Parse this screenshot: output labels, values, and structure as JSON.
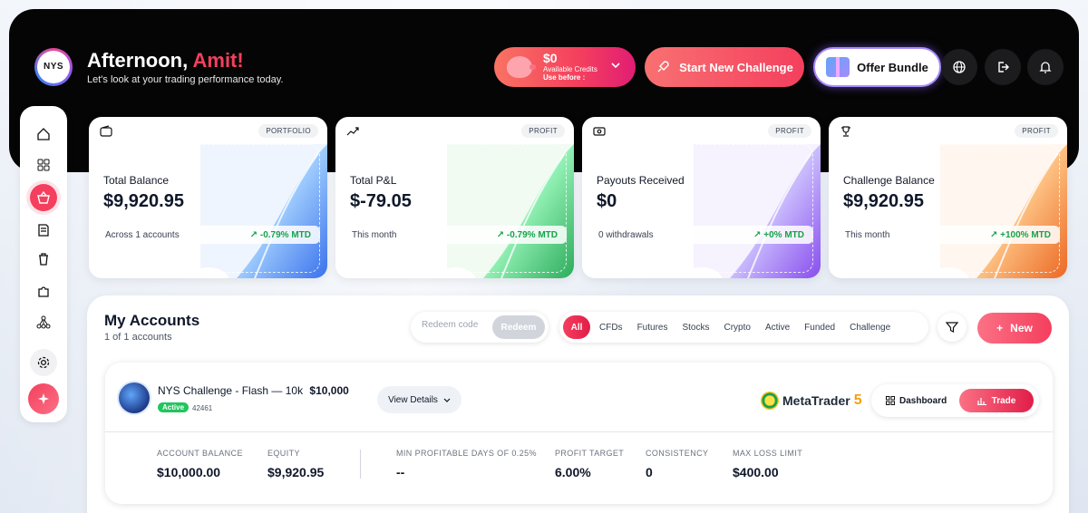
{
  "header": {
    "greeting_prefix": "Afternoon,",
    "greeting_name": "Amit!",
    "subtitle": "Let's look at your trading performance today.",
    "logo_text": "NYS",
    "credits": {
      "amount": "$0",
      "label": "Available Credits",
      "use_before": "Use before :"
    },
    "start_challenge_label": "Start New Challenge",
    "offer_bundle_label": "Offer Bundle",
    "icons": [
      "globe-icon",
      "logout-icon",
      "bell-icon"
    ]
  },
  "sidebar": {
    "items": [
      "home-icon",
      "grid-icon",
      "basket-icon",
      "document-icon",
      "trash-icon",
      "puzzle-icon",
      "network-icon",
      "settings-icon",
      "sparkle-icon"
    ]
  },
  "stats": [
    {
      "tag": "PORTFOLIO",
      "title": "Total Balance",
      "value": "$9,920.95",
      "foot_left": "Across 1 accounts",
      "trend": "-0.79% MTD",
      "accent": "#3b82f6"
    },
    {
      "tag": "PROFIT",
      "title": "Total P&L",
      "value": "$-79.05",
      "foot_left": "This month",
      "trend": "-0.79% MTD",
      "accent": "#22c55e"
    },
    {
      "tag": "PROFIT",
      "title": "Payouts Received",
      "value": "$0",
      "foot_left": "0 withdrawals",
      "trend": "+0% MTD",
      "accent": "#8b5cf6"
    },
    {
      "tag": "PROFIT",
      "title": "Challenge Balance",
      "value": "$9,920.95",
      "foot_left": "This month",
      "trend": "+100% MTD",
      "accent": "#f97316"
    }
  ],
  "accounts": {
    "title": "My Accounts",
    "subtitle": "1 of 1 accounts",
    "redeem_placeholder": "Redeem code",
    "redeem_button": "Redeem",
    "filters": [
      "All",
      "CFDs",
      "Futures",
      "Stocks",
      "Crypto",
      "Active",
      "Funded",
      "Challenge"
    ],
    "active_filter": "All",
    "new_button": "New",
    "item": {
      "name": "NYS Challenge - Flash — 10k",
      "amount": "$10,000",
      "status": "Active",
      "id": "42461",
      "view_details": "View Details",
      "platform": "MetaTrader",
      "platform_version": "5",
      "dashboard_label": "Dashboard",
      "trade_label": "Trade",
      "metrics": [
        {
          "label": "ACCOUNT BALANCE",
          "value": "$10,000.00"
        },
        {
          "label": "EQUITY",
          "value": "$9,920.95"
        },
        {
          "label": "MIN PROFITABLE DAYS OF 0.25%",
          "value": "--"
        },
        {
          "label": "PROFIT TARGET",
          "value": "6.00%"
        },
        {
          "label": "CONSISTENCY",
          "value": "0"
        },
        {
          "label": "MAX LOSS LIMIT",
          "value": "$400.00"
        }
      ]
    }
  },
  "colors": {
    "accent": "#f43f5e",
    "positive": "#16a34a",
    "header_bg": "#050505"
  }
}
